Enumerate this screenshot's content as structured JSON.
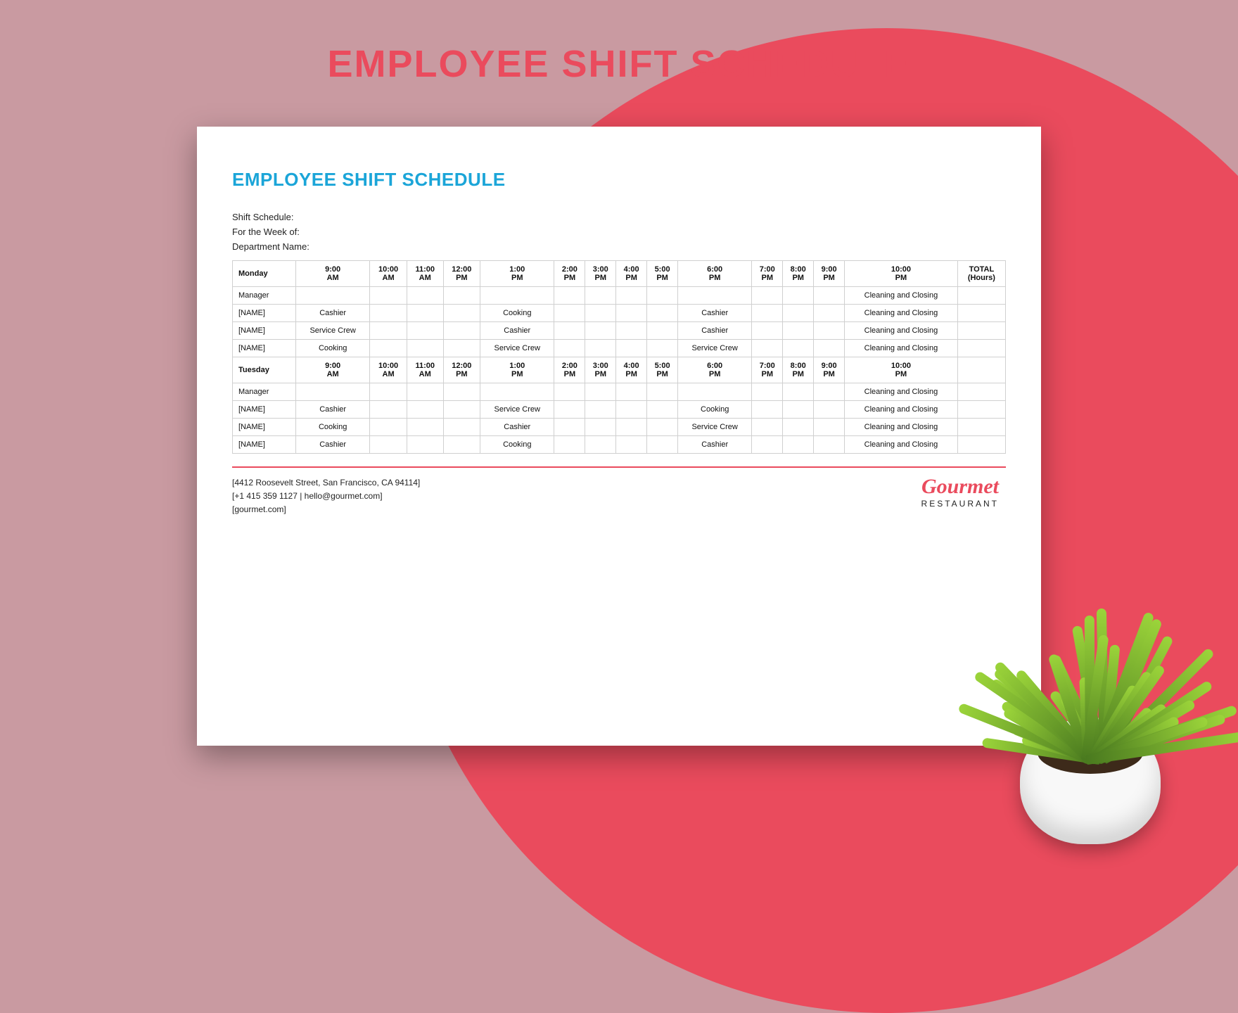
{
  "banner": "EMPLOYEE SHIFT SCHEDULE",
  "doc_title": "EMPLOYEE SHIFT SCHEDULE",
  "meta": {
    "line1": "Shift Schedule:",
    "line2": "For the Week of:",
    "line3": "Department Name:"
  },
  "time_headers": [
    "9:00 AM",
    "10:00 AM",
    "11:00 AM",
    "12:00 PM",
    "1:00 PM",
    "2:00 PM",
    "3:00 PM",
    "4:00 PM",
    "5:00 PM",
    "6:00 PM",
    "7:00 PM",
    "8:00 PM",
    "9:00 PM",
    "10:00 PM"
  ],
  "total_header": "TOTAL (Hours)",
  "days": [
    {
      "name": "Monday",
      "rows": [
        {
          "label": "Manager",
          "cells": [
            "",
            "",
            "",
            "",
            "",
            "",
            "",
            "",
            "",
            "",
            "",
            "",
            "",
            "Cleaning and Closing",
            ""
          ]
        },
        {
          "label": "[NAME]",
          "cells": [
            "Cashier",
            "",
            "",
            "",
            "Cooking",
            "",
            "",
            "",
            "",
            "Cashier",
            "",
            "",
            "",
            "Cleaning and Closing",
            ""
          ]
        },
        {
          "label": "[NAME]",
          "cells": [
            "Service Crew",
            "",
            "",
            "",
            "Cashier",
            "",
            "",
            "",
            "",
            "Cashier",
            "",
            "",
            "",
            "Cleaning and Closing",
            ""
          ]
        },
        {
          "label": "[NAME]",
          "cells": [
            "Cooking",
            "",
            "",
            "",
            "Service Crew",
            "",
            "",
            "",
            "",
            "Service Crew",
            "",
            "",
            "",
            "Cleaning and Closing",
            ""
          ]
        }
      ]
    },
    {
      "name": "Tuesday",
      "rows": [
        {
          "label": "Manager",
          "cells": [
            "",
            "",
            "",
            "",
            "",
            "",
            "",
            "",
            "",
            "",
            "",
            "",
            "",
            "Cleaning and Closing",
            ""
          ]
        },
        {
          "label": "[NAME]",
          "cells": [
            "Cashier",
            "",
            "",
            "",
            "Service Crew",
            "",
            "",
            "",
            "",
            "Cooking",
            "",
            "",
            "",
            "Cleaning and Closing",
            ""
          ]
        },
        {
          "label": "[NAME]",
          "cells": [
            "Cooking",
            "",
            "",
            "",
            "Cashier",
            "",
            "",
            "",
            "",
            "Service Crew",
            "",
            "",
            "",
            "Cleaning and Closing",
            ""
          ]
        },
        {
          "label": "[NAME]",
          "cells": [
            "Cashier",
            "",
            "",
            "",
            "Cooking",
            "",
            "",
            "",
            "",
            "Cashier",
            "",
            "",
            "",
            "Cleaning and Closing",
            ""
          ]
        }
      ]
    }
  ],
  "footer": {
    "address": "[4412 Roosevelt Street, San Francisco, CA 94114]",
    "phone_email": "[+1 415 359 1127 | hello@gourmet.com]",
    "website": "[gourmet.com]",
    "logo_main": "Gourmet",
    "logo_sub": "RESTAURANT"
  }
}
